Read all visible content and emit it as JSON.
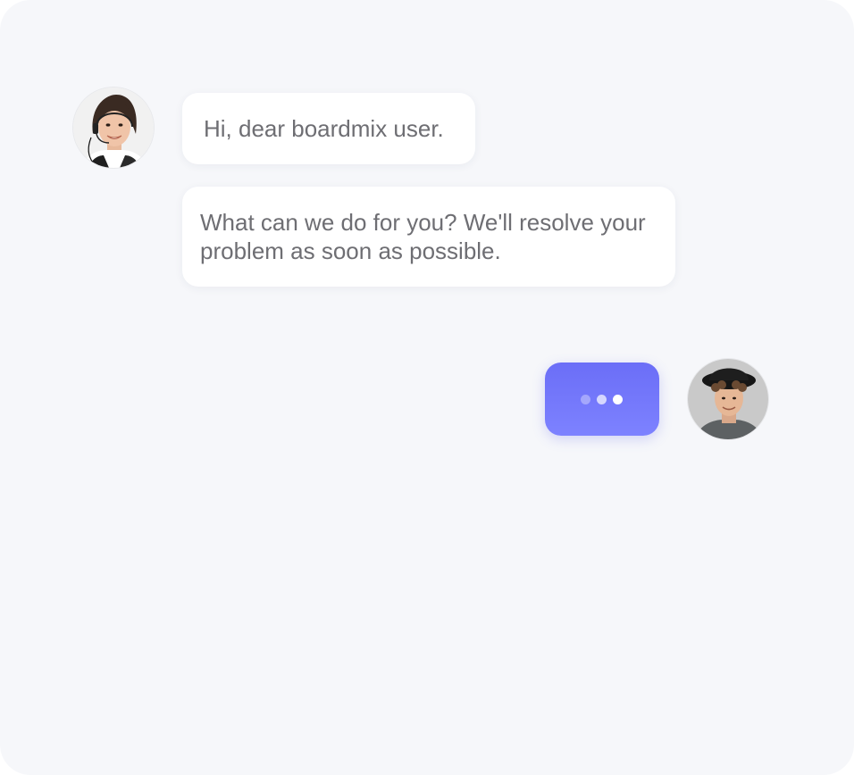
{
  "chat": {
    "messages": [
      {
        "sender": "agent",
        "text": "Hi, dear boardmix user."
      },
      {
        "sender": "agent",
        "text": "What can we do for you? We'll resolve your problem as soon as possible."
      }
    ],
    "typing_indicator": {
      "sender": "user",
      "dots": 3
    }
  },
  "avatars": {
    "agent": "support-agent-with-headset",
    "user": "young-man-with-hat"
  },
  "colors": {
    "background": "#f6f7fa",
    "bubble": "#ffffff",
    "message_text": "#6e6e73",
    "typing_indicator": "#6b6ef7"
  }
}
